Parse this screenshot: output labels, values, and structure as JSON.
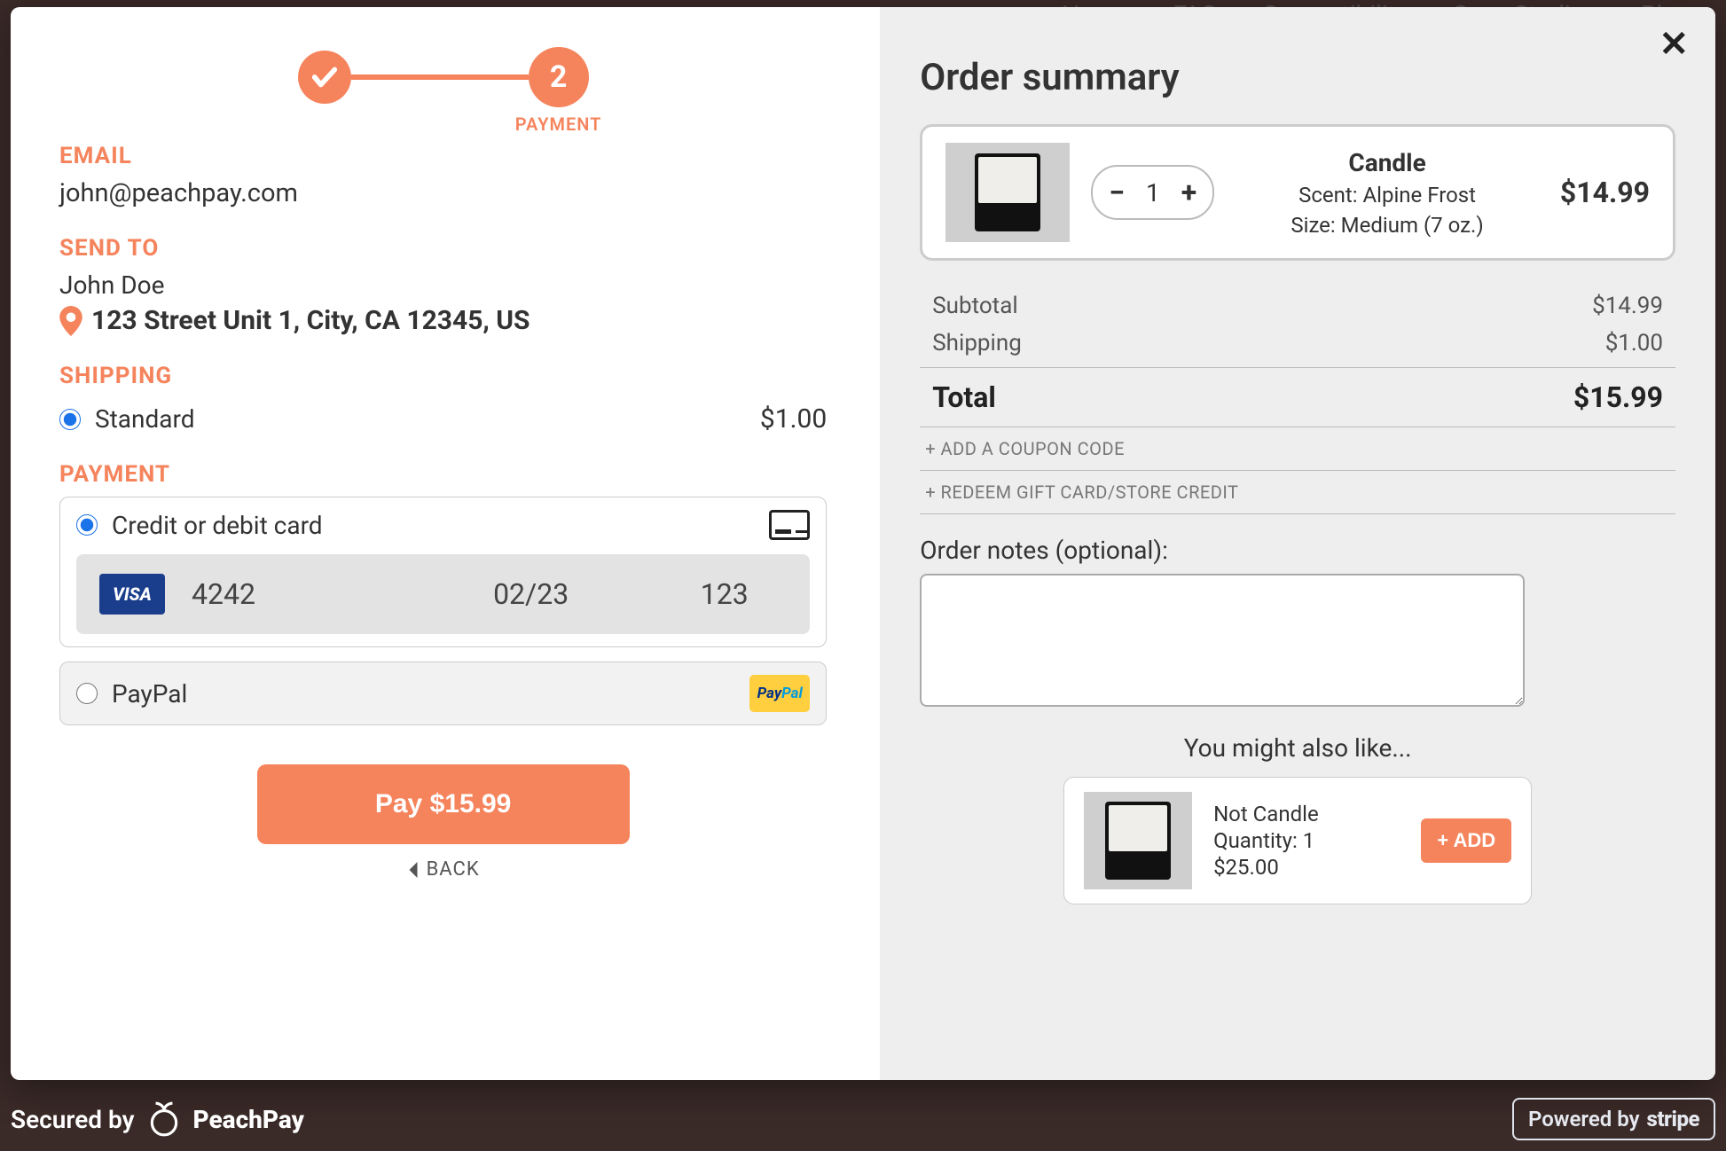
{
  "bg_nav": [
    "Home",
    "FAQ",
    "Compatibility",
    "Case Studies",
    "Blog"
  ],
  "stepper": {
    "step2_num": "2",
    "step2_label": "PAYMENT"
  },
  "sections": {
    "email_label": "EMAIL",
    "sendto_label": "SEND TO",
    "shipping_label": "SHIPPING",
    "payment_label": "PAYMENT"
  },
  "email": "john@peachpay.com",
  "send_to": {
    "name": "John Doe",
    "address": "123 Street Unit 1, City, CA 12345, US"
  },
  "shipping": {
    "option_label": "Standard",
    "price": "$1.00",
    "selected": true
  },
  "payment": {
    "card_label": "Credit or debit card",
    "card_brand": "VISA",
    "card_last": "4242",
    "card_exp": "02/23",
    "card_cvv": "123",
    "paypal_label": "PayPal"
  },
  "pay_button": "Pay $15.99",
  "back_label": "BACK",
  "summary": {
    "title": "Order summary",
    "item": {
      "name": "Candle",
      "attrs": [
        "Scent: Alpine Frost",
        "Size: Medium (7 oz.)"
      ],
      "qty": "1",
      "price": "$14.99"
    },
    "subtotal_label": "Subtotal",
    "subtotal": "$14.99",
    "shipping_label": "Shipping",
    "shipping": "$1.00",
    "total_label": "Total",
    "total": "$15.99",
    "coupon_link": "+ ADD A COUPON CODE",
    "gift_link": "+ REDEEM GIFT CARD/STORE CREDIT",
    "notes_label": "Order notes (optional):",
    "also_title": "You might also like...",
    "upsell": {
      "name": "Not Candle",
      "qty_label": "Quantity: 1",
      "price": "$25.00",
      "add_label": "+ ADD"
    }
  },
  "footer": {
    "secured_by": "Secured by",
    "brand": "PeachPay",
    "stripe_prefix": "Powered by",
    "stripe": "stripe"
  }
}
